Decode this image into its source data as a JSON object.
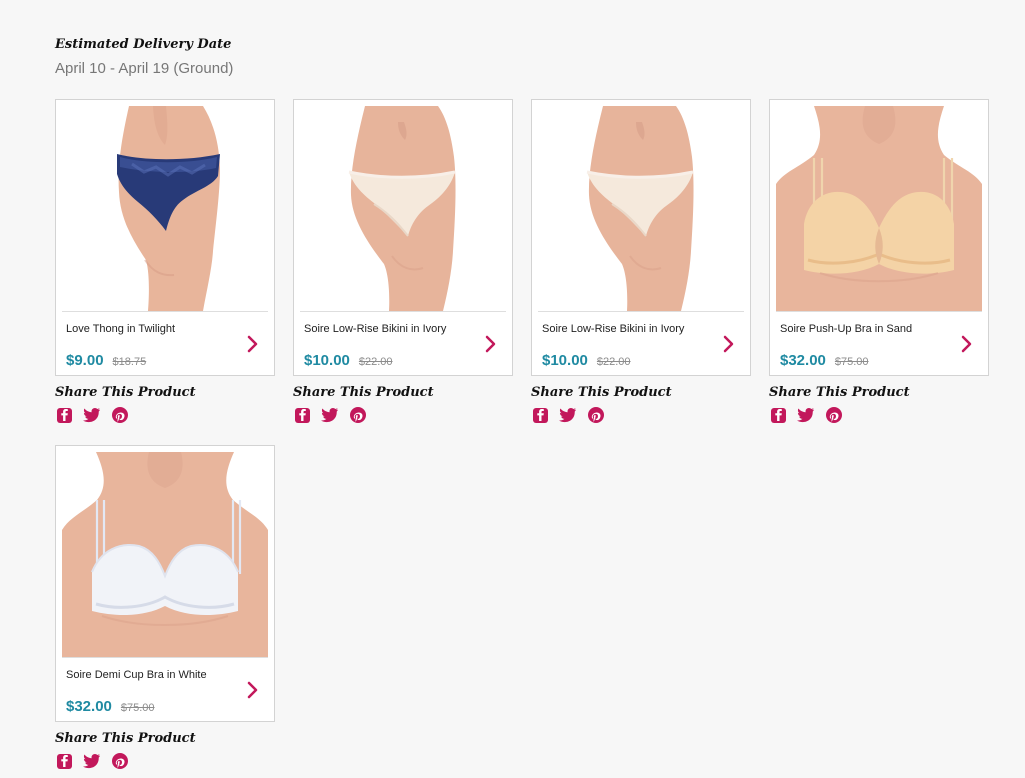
{
  "delivery": {
    "title": "Estimated Delivery Date",
    "dates": "April 10 - April 19 (Ground)"
  },
  "share": {
    "title": "Share This Product"
  },
  "colors": {
    "accent": "#c2185b",
    "price": "#1f8aa2"
  },
  "products": [
    {
      "name": "Love Thong in Twilight",
      "price": "$9.00",
      "old_price": "$18.75",
      "image": "navy-lace-thong"
    },
    {
      "name": "Soire Low-Rise Bikini in Ivory",
      "price": "$10.00",
      "old_price": "$22.00",
      "image": "ivory-bikini"
    },
    {
      "name": "Soire Low-Rise Bikini in Ivory",
      "price": "$10.00",
      "old_price": "$22.00",
      "image": "ivory-bikini"
    },
    {
      "name": "Soire Push-Up Bra in Sand",
      "price": "$32.00",
      "old_price": "$75.00",
      "image": "sand-push-up-bra"
    },
    {
      "name": "Soire Demi Cup Bra in White",
      "price": "$32.00",
      "old_price": "$75.00",
      "image": "white-demi-cup-bra"
    }
  ],
  "icons": {
    "details": "chevron-right-icon",
    "facebook": "facebook-icon",
    "twitter": "twitter-icon",
    "pinterest": "pinterest-icon"
  }
}
